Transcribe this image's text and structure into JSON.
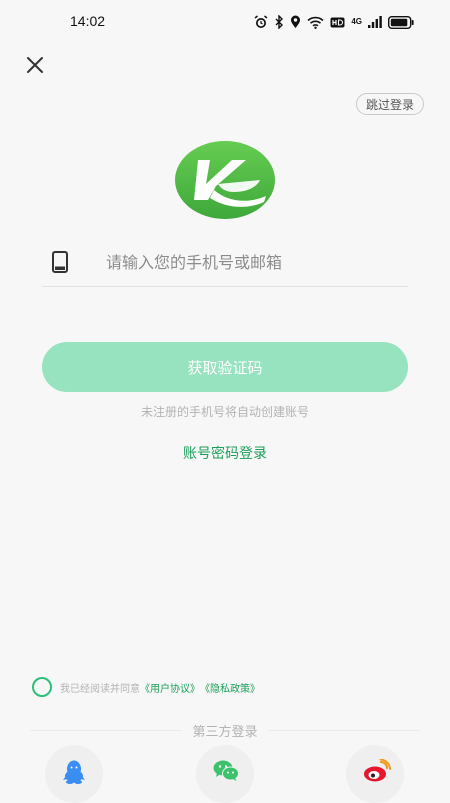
{
  "status_bar": {
    "time": "14:02",
    "network_label": "4G",
    "icons": [
      "alarm-icon",
      "bluetooth-icon",
      "location-icon",
      "wifi-icon",
      "hd-icon",
      "signal-icon",
      "battery-icon"
    ]
  },
  "login": {
    "skip_label": "跳过登录",
    "phone_placeholder": "请输入您的手机号或邮箱",
    "phone_value": "",
    "get_code_label": "获取验证码",
    "hint": "未注册的手机号将自动创建账号",
    "password_login_label": "账号密码登录"
  },
  "agreement": {
    "prefix": "我已经阅读并同意",
    "user_agreement": "《用户协议》",
    "privacy_policy": "《隐私政策》",
    "checked": false
  },
  "third_party": {
    "title": "第三方登录",
    "providers": [
      "qq-icon",
      "wechat-icon",
      "weibo-icon"
    ]
  },
  "colors": {
    "accent": "#1b9f5a",
    "button_disabled": "#98e3bf",
    "logo_green": "#4cbd45",
    "background": "#f7f7f7"
  }
}
